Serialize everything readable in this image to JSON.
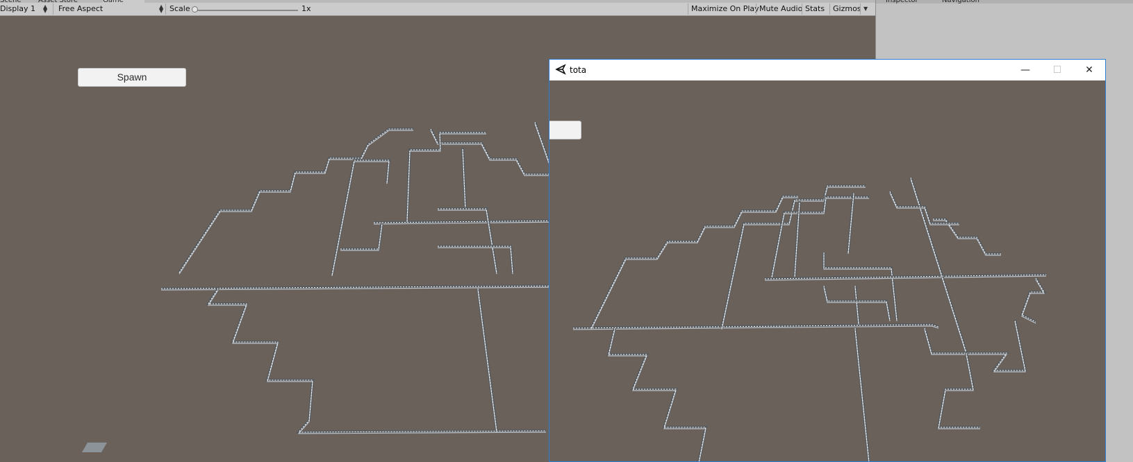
{
  "editor": {
    "tabs": [
      "Scene",
      "Asset Store",
      "Game"
    ],
    "toolbar": {
      "display": "Display 1",
      "aspect": "Free Aspect",
      "scale_label": "Scale",
      "scale_value": "1x",
      "maximize": "Maximize On Play",
      "mute": "Mute Audio",
      "stats": "Stats",
      "gizmos": "Gizmos"
    },
    "right_tabs": [
      "Inspector",
      "Navigation"
    ]
  },
  "game": {
    "spawn_label": "Spawn"
  },
  "player_window": {
    "title": "tota",
    "minimize": "—",
    "maximize": "☐",
    "close": "✕"
  },
  "colors": {
    "background": "#6b615b",
    "road": "#555a5e",
    "road_edge": "#c0c6cc",
    "accent": "#2c7fd6"
  },
  "icons": [
    "unity-logo-icon",
    "minimize-icon",
    "maximize-icon",
    "close-icon"
  ]
}
